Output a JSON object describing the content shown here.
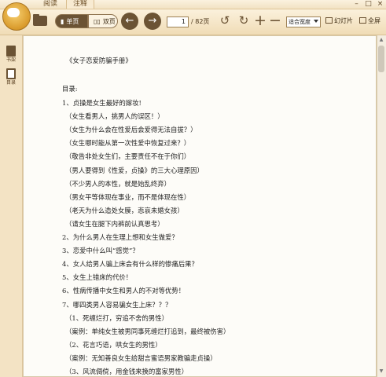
{
  "tabs": [
    {
      "label": "阅读"
    },
    {
      "label": "注释"
    }
  ],
  "window": {
    "min": "–",
    "max": "□",
    "close": "×"
  },
  "toolbar": {
    "single_page": "单页",
    "double_page": "双页",
    "page_value": "1",
    "page_total": "/ 82页",
    "fit_value": "适合宽度",
    "slides": "幻灯片",
    "fullscreen": "全屏"
  },
  "rail": {
    "shelf": "书架",
    "toc": "目录"
  },
  "icons": {
    "logo": "app-logo-icon",
    "open": "folder-icon",
    "prev": "arrow-left-icon",
    "next": "arrow-right-icon",
    "rotate_ccw": "rotate-ccw-icon",
    "rotate_cw": "rotate-cw-icon",
    "zoom_in": "plus-icon",
    "zoom_out": "minus-icon"
  },
  "colors": {
    "accent": "#6b5334",
    "chrome": "#f3e3c4",
    "page": "#fdfcf8"
  },
  "document": {
    "title": "《女子恋爱防骗手册》",
    "toc_heading": "目录:",
    "lines": [
      {
        "text": "1、贞操是女生最好的嫁妆!",
        "indent": 0
      },
      {
        "text": "（女生看男人，挑男人的误区！）",
        "indent": 1
      },
      {
        "text": "（女生为什么会在性爱后会爱得无法自拔？）",
        "indent": 1
      },
      {
        "text": "（女生哪时能从第一次性爱中恢复过来？）",
        "indent": 1
      },
      {
        "text": "（敬告非处女生们，主要责任不在于你们）",
        "indent": 1
      },
      {
        "text": "（男人要得到《性爱，贞操》的三大心理原因）",
        "indent": 1
      },
      {
        "text": "（不少男人的本性，就是始乱终弃）",
        "indent": 1
      },
      {
        "text": "（男女平等体现在事业，而不是体现在性）",
        "indent": 1
      },
      {
        "text": "（老天为什么造处女膜，悲哀未婚女孩）",
        "indent": 1
      },
      {
        "text": "（请女生在腿下内裤前认真思考）",
        "indent": 1
      },
      {
        "text": "2、为什么男人在生理上想和女生做爱？",
        "indent": 0
      },
      {
        "text": "3、恋爱中什么叫“感觉”？",
        "indent": 0
      },
      {
        "text": "4、女人给男人骗上床会有什么样的惨痛后果？",
        "indent": 0
      },
      {
        "text": "5、女生上错床的代价！",
        "indent": 0
      },
      {
        "text": "6、性病传播中女生和男人的不对等优势！",
        "indent": 0
      },
      {
        "text": "7、哪四类男人容易骗女生上床？？？",
        "indent": 0
      },
      {
        "text": "（1、死缠烂打，穷追不舍的男性）",
        "indent": 1
      },
      {
        "text": "（案例：单纯女生被男同事死缠烂打追到，最终被伤害）",
        "indent": 1
      },
      {
        "text": "（2、花言巧语，哄女生的男性）",
        "indent": 1
      },
      {
        "text": "（案例：无知善良女生给甜言蜜语男家教骗走贞操）",
        "indent": 1
      },
      {
        "text": "（3、风流倜傥，用金钱来换的富家男性）",
        "indent": 1
      }
    ]
  }
}
